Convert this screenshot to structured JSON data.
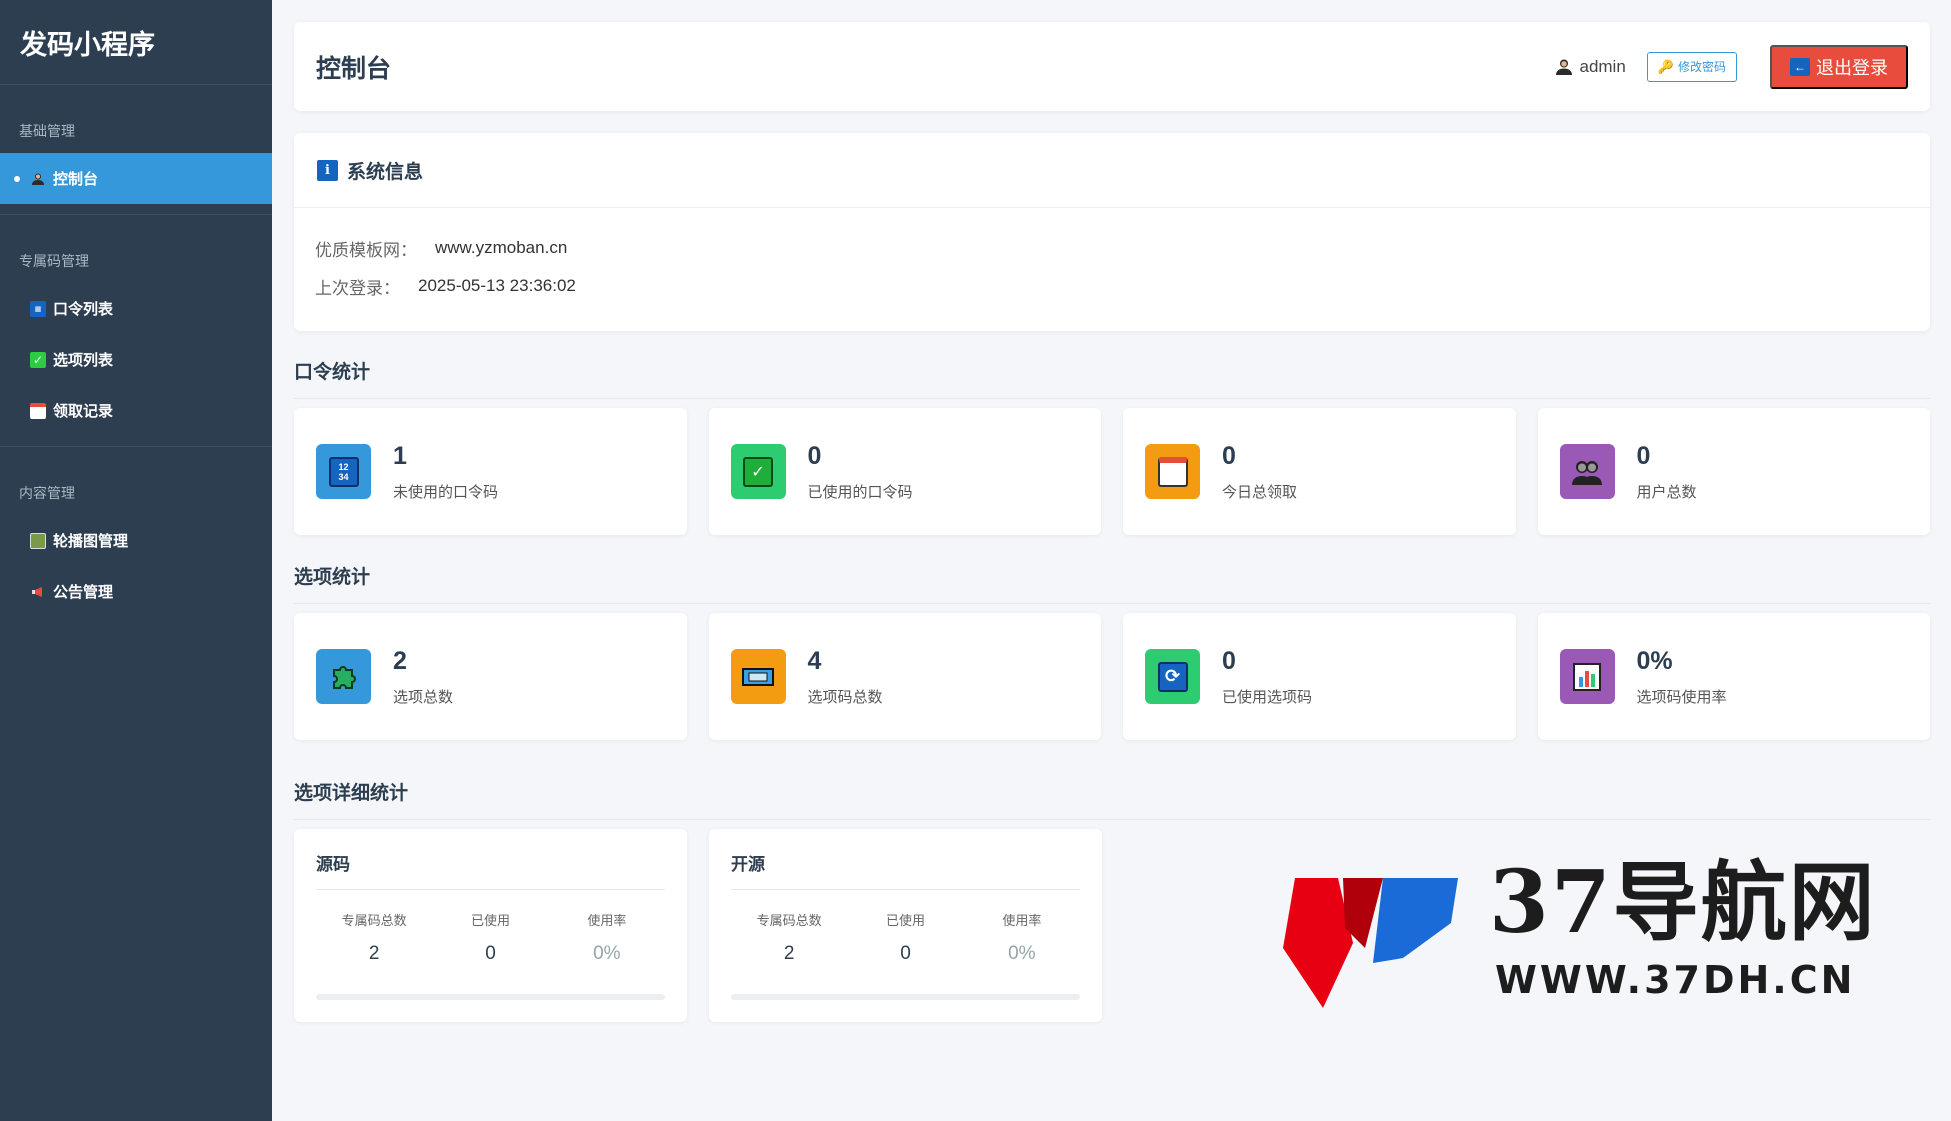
{
  "sidebar": {
    "brand": "发码小程序",
    "groups": [
      {
        "title": "基础管理",
        "items": [
          {
            "label": "控制台",
            "icon": "user-icon",
            "active": true
          }
        ]
      },
      {
        "title": "专属码管理",
        "items": [
          {
            "label": "口令列表",
            "icon": "numbers-icon"
          },
          {
            "label": "选项列表",
            "icon": "check-icon"
          },
          {
            "label": "领取记录",
            "icon": "calendar-icon"
          }
        ]
      },
      {
        "title": "内容管理",
        "items": [
          {
            "label": "轮播图管理",
            "icon": "image-icon"
          },
          {
            "label": "公告管理",
            "icon": "megaphone-icon"
          }
        ]
      }
    ]
  },
  "header": {
    "title": "控制台",
    "username": "admin",
    "change_password": "修改密码",
    "logout": "退出登录"
  },
  "system_info": {
    "title": "系统信息",
    "rows": [
      {
        "label": "优质模板网：",
        "value": "www.yzmoban.cn"
      },
      {
        "label": "上次登录：",
        "value": "2025-05-13 23:36:02"
      }
    ]
  },
  "code_stats": {
    "title": "口令统计",
    "cards": [
      {
        "value": "1",
        "label": "未使用的口令码",
        "icon": "numbers-icon",
        "color": "#3498db"
      },
      {
        "value": "0",
        "label": "已使用的口令码",
        "icon": "check-icon",
        "color": "#2ecc71"
      },
      {
        "value": "0",
        "label": "今日总领取",
        "icon": "calendar-icon",
        "color": "#f39c12"
      },
      {
        "value": "0",
        "label": "用户总数",
        "icon": "users-icon",
        "color": "#9b59b6"
      }
    ]
  },
  "option_stats": {
    "title": "选项统计",
    "cards": [
      {
        "value": "2",
        "label": "选项总数",
        "icon": "puzzle-icon",
        "color": "#3498db"
      },
      {
        "value": "4",
        "label": "选项码总数",
        "icon": "ticket-icon",
        "color": "#f39c12"
      },
      {
        "value": "0",
        "label": "已使用选项码",
        "icon": "refresh-icon",
        "color": "#2ecc71"
      },
      {
        "value": "0%",
        "label": "选项码使用率",
        "icon": "bar-chart-icon",
        "color": "#9b59b6"
      }
    ]
  },
  "option_detail": {
    "title": "选项详细统计",
    "cards": [
      {
        "title": "源码",
        "cols": [
          {
            "label": "专属码总数",
            "value": "2"
          },
          {
            "label": "已使用",
            "value": "0"
          },
          {
            "label": "使用率",
            "value": "0%"
          }
        ],
        "usage_fraction": 0
      },
      {
        "title": "开源",
        "cols": [
          {
            "label": "专属码总数",
            "value": "2"
          },
          {
            "label": "已使用",
            "value": "0"
          },
          {
            "label": "使用率",
            "value": "0%"
          }
        ],
        "usage_fraction": 0
      }
    ]
  },
  "watermark": {
    "text": "37导航网",
    "url": "WWW.37DH.CN"
  },
  "colors": {
    "sidebar_bg": "#2c3e50",
    "accent": "#3498db",
    "danger": "#e74c3c"
  }
}
